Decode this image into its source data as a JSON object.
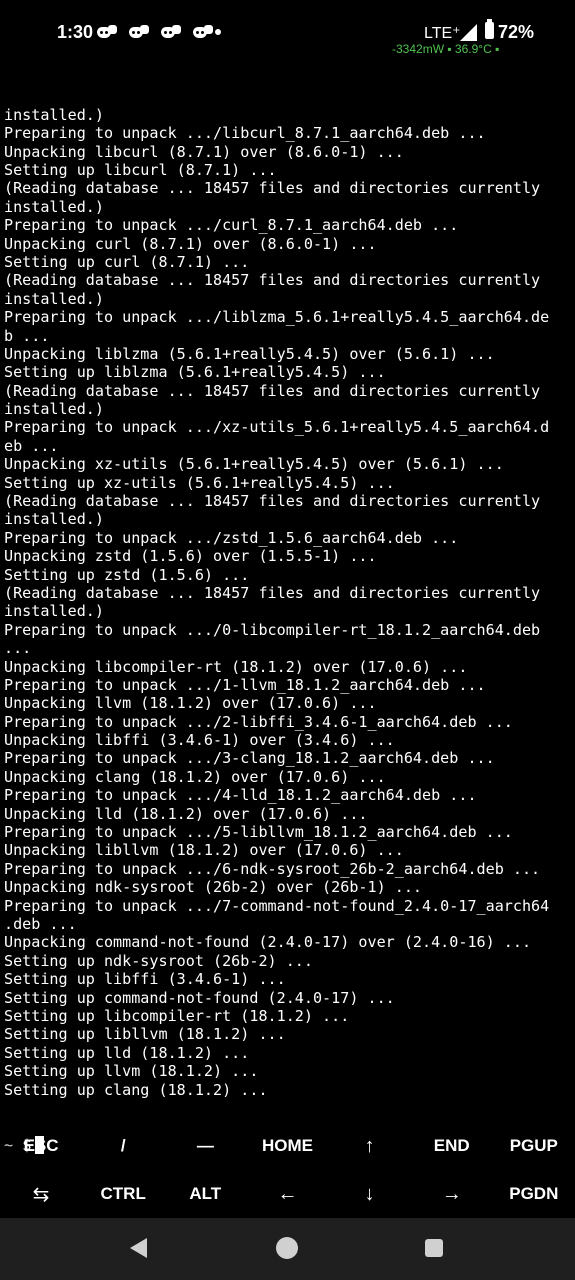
{
  "status_bar": {
    "time": "1:30",
    "notification_icons": [
      "discord-icon",
      "discord-icon",
      "discord-icon",
      "discord-icon"
    ],
    "network": "LTE⁺",
    "battery_percent": "72%",
    "power_info": "-3342mW ▪ 36.9°C ▪"
  },
  "terminal": {
    "lines": [
      "installed.)",
      "Preparing to unpack .../libcurl_8.7.1_aarch64.deb ...",
      "Unpacking libcurl (8.7.1) over (8.6.0-1) ...",
      "Setting up libcurl (8.7.1) ...",
      "(Reading database ... 18457 files and directories currently",
      "installed.)",
      "Preparing to unpack .../curl_8.7.1_aarch64.deb ...",
      "Unpacking curl (8.7.1) over (8.6.0-1) ...",
      "Setting up curl (8.7.1) ...",
      "(Reading database ... 18457 files and directories currently",
      "installed.)",
      "Preparing to unpack .../liblzma_5.6.1+really5.4.5_aarch64.de",
      "b ...",
      "Unpacking liblzma (5.6.1+really5.4.5) over (5.6.1) ...",
      "Setting up liblzma (5.6.1+really5.4.5) ...",
      "(Reading database ... 18457 files and directories currently",
      "installed.)",
      "Preparing to unpack .../xz-utils_5.6.1+really5.4.5_aarch64.d",
      "eb ...",
      "Unpacking xz-utils (5.6.1+really5.4.5) over (5.6.1) ...",
      "Setting up xz-utils (5.6.1+really5.4.5) ...",
      "(Reading database ... 18457 files and directories currently",
      "installed.)",
      "Preparing to unpack .../zstd_1.5.6_aarch64.deb ...",
      "Unpacking zstd (1.5.6) over (1.5.5-1) ...",
      "Setting up zstd (1.5.6) ...",
      "(Reading database ... 18457 files and directories currently",
      "installed.)",
      "Preparing to unpack .../0-libcompiler-rt_18.1.2_aarch64.deb",
      "...",
      "Unpacking libcompiler-rt (18.1.2) over (17.0.6) ...",
      "Preparing to unpack .../1-llvm_18.1.2_aarch64.deb ...",
      "Unpacking llvm (18.1.2) over (17.0.6) ...",
      "Preparing to unpack .../2-libffi_3.4.6-1_aarch64.deb ...",
      "Unpacking libffi (3.4.6-1) over (3.4.6) ...",
      "Preparing to unpack .../3-clang_18.1.2_aarch64.deb ...",
      "Unpacking clang (18.1.2) over (17.0.6) ...",
      "Preparing to unpack .../4-lld_18.1.2_aarch64.deb ...",
      "Unpacking lld (18.1.2) over (17.0.6) ...",
      "Preparing to unpack .../5-libllvm_18.1.2_aarch64.deb ...",
      "Unpacking libllvm (18.1.2) over (17.0.6) ...",
      "Preparing to unpack .../6-ndk-sysroot_26b-2_aarch64.deb ...",
      "Unpacking ndk-sysroot (26b-2) over (26b-1) ...",
      "Preparing to unpack .../7-command-not-found_2.4.0-17_aarch64",
      ".deb ...",
      "Unpacking command-not-found (2.4.0-17) over (2.4.0-16) ...",
      "Setting up ndk-sysroot (26b-2) ...",
      "Setting up libffi (3.4.6-1) ...",
      "Setting up command-not-found (2.4.0-17) ...",
      "Setting up libcompiler-rt (18.1.2) ...",
      "Setting up libllvm (18.1.2) ...",
      "Setting up lld (18.1.2) ...",
      "Setting up llvm (18.1.2) ...",
      "Setting up clang (18.1.2) ..."
    ],
    "prompt_tilde": "~",
    "prompt_symbol": "$"
  },
  "extra_keys": {
    "row1": [
      "ESC",
      "/",
      "—",
      "HOME",
      "↑",
      "END",
      "PGUP"
    ],
    "row2": [
      "⇆",
      "CTRL",
      "ALT",
      "←",
      "↓",
      "→",
      "PGDN"
    ]
  },
  "nav": {
    "icons": [
      "back-icon",
      "home-icon",
      "recents-icon"
    ]
  }
}
